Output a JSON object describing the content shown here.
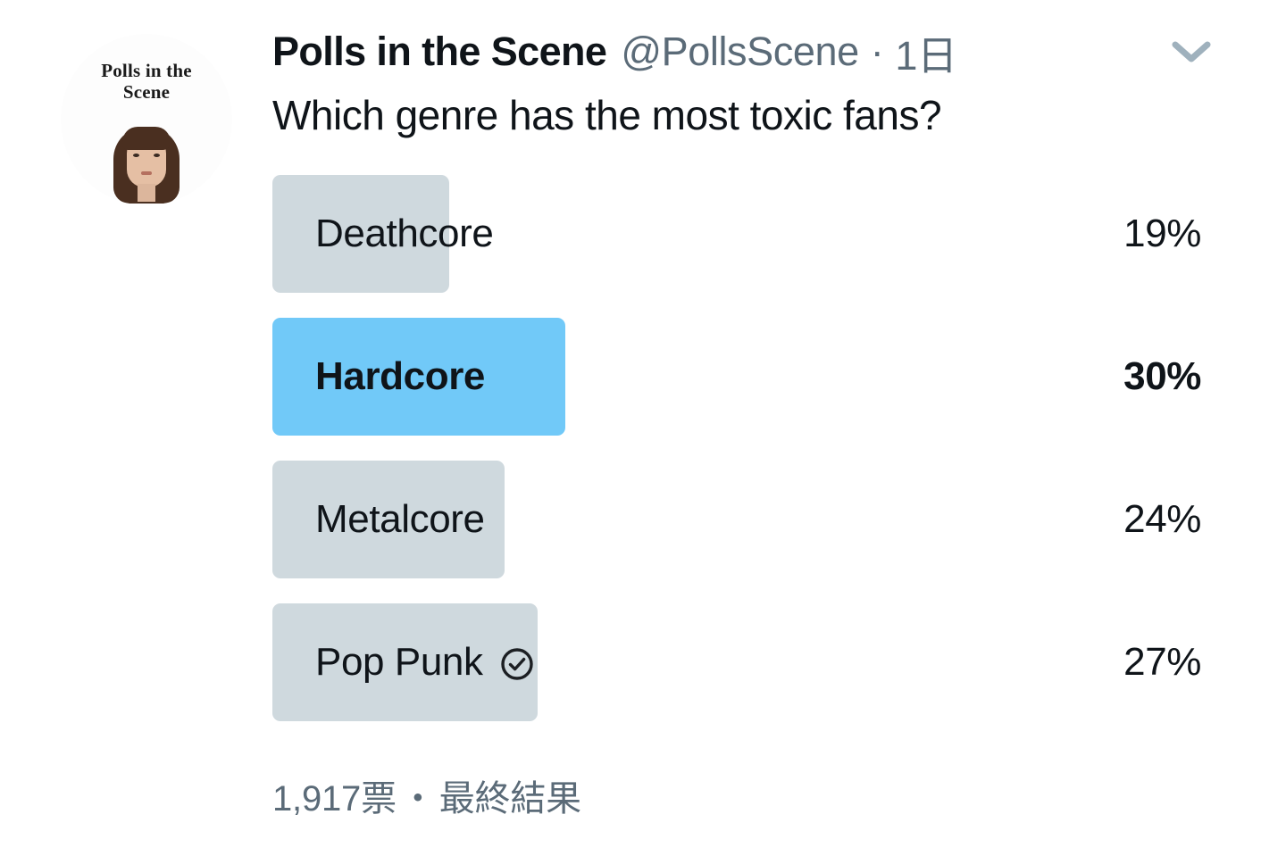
{
  "tweet": {
    "avatar": {
      "text_line1": "Polls in the",
      "text_line2": "Scene",
      "alt": "profile-photo"
    },
    "display_name": "Polls in the Scene",
    "handle": "@PollsScene",
    "separator": "·",
    "timestamp": "1日",
    "caret_icon": "chevron-down-icon",
    "question": "Which genre has the most toxic fans?"
  },
  "poll": {
    "options": [
      {
        "label": "Deathcore",
        "percent": "19%",
        "value": 19,
        "winner": false,
        "voted": false
      },
      {
        "label": "Hardcore",
        "percent": "30%",
        "value": 30,
        "winner": true,
        "voted": false
      },
      {
        "label": "Metalcore",
        "percent": "24%",
        "value": 24,
        "winner": false,
        "voted": false
      },
      {
        "label": "Pop Punk",
        "percent": "27%",
        "value": 27,
        "winner": false,
        "voted": true,
        "vote_icon": "check-circle-icon"
      }
    ],
    "footer": {
      "votes": "1,917票",
      "dot": "・",
      "status": "最終結果"
    },
    "colors": {
      "bar_default": "#cfd9de",
      "bar_winner": "#71c9f8",
      "text_primary": "#0f1419",
      "text_secondary": "#5b6b78"
    }
  },
  "chart_data": {
    "type": "bar",
    "title": "Which genre has the most toxic fans?",
    "categories": [
      "Deathcore",
      "Hardcore",
      "Metalcore",
      "Pop Punk"
    ],
    "values": [
      19,
      30,
      24,
      27
    ],
    "value_labels": [
      "19%",
      "30%",
      "24%",
      "27%"
    ],
    "unit": "percent",
    "total_votes": 1917,
    "total_votes_label": "1,917票",
    "status_label": "最終結果",
    "winner": "Hardcore",
    "user_vote": "Pop Punk",
    "orientation": "horizontal",
    "xlabel": "",
    "ylabel": "",
    "xlim": [
      0,
      100
    ],
    "grid": false,
    "legend": false
  }
}
